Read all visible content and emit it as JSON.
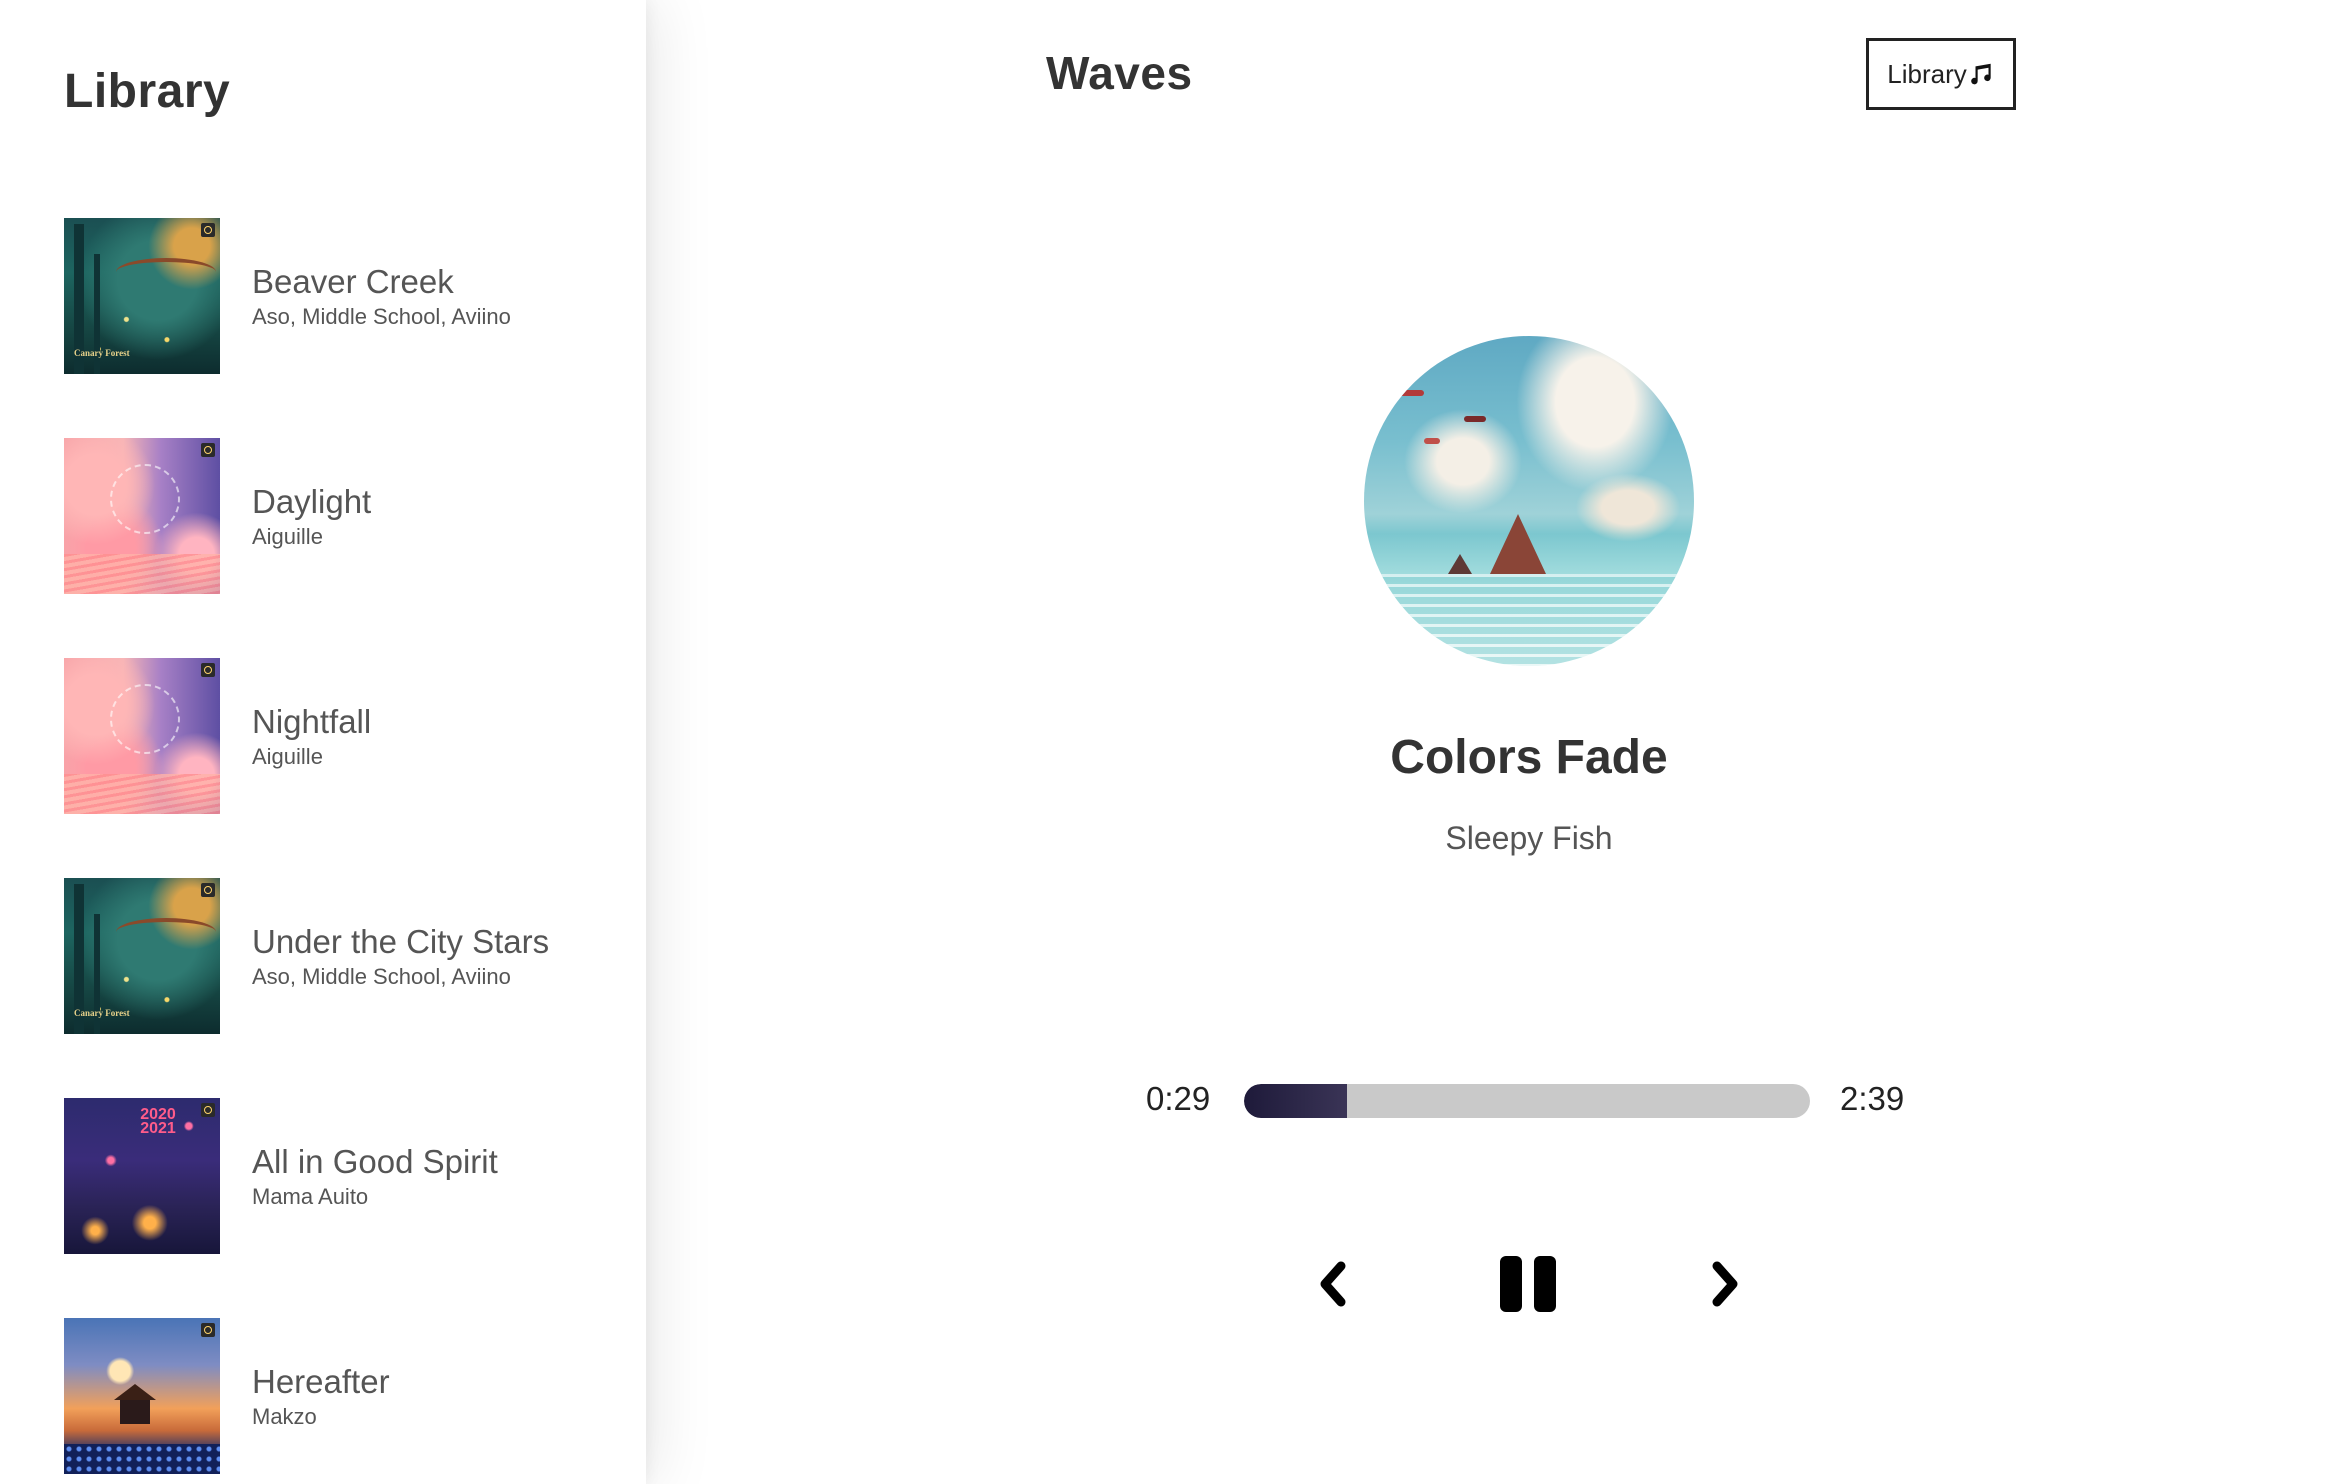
{
  "library": {
    "title": "Library",
    "songs": [
      {
        "name": "Beaver Creek",
        "artist": "Aso, Middle School, Aviino",
        "cover": "forest",
        "cover_caption": "Canary Forest"
      },
      {
        "name": "Daylight",
        "artist": "Aiguille",
        "cover": "pink"
      },
      {
        "name": "Nightfall",
        "artist": "Aiguille",
        "cover": "pink"
      },
      {
        "name": "Under the City Stars",
        "artist": "Aso, Middle School, Aviino",
        "cover": "forest",
        "cover_caption": "Canary Forest"
      },
      {
        "name": "All in Good Spirit",
        "artist": "Mama Auito",
        "cover": "night",
        "cover_caption": "2020 2021"
      },
      {
        "name": "Hereafter",
        "artist": "Makzo",
        "cover": "sunset"
      }
    ]
  },
  "header": {
    "brand": "Waves",
    "library_button": "Library",
    "library_button_icon": "music-note-icon"
  },
  "now_playing": {
    "title": "Colors Fade",
    "artist": "Sleepy Fish",
    "current_time": "0:29",
    "duration": "2:39",
    "progress_fraction": 0.182
  },
  "controls": {
    "prev_icon": "chevron-left-icon",
    "play_icon": "pause-icon",
    "next_icon": "chevron-right-icon"
  },
  "colors": {
    "progress_fill": "#1e1a3a",
    "progress_track": "#c9c9c9",
    "text_primary": "#333333",
    "text_secondary": "#555555"
  }
}
